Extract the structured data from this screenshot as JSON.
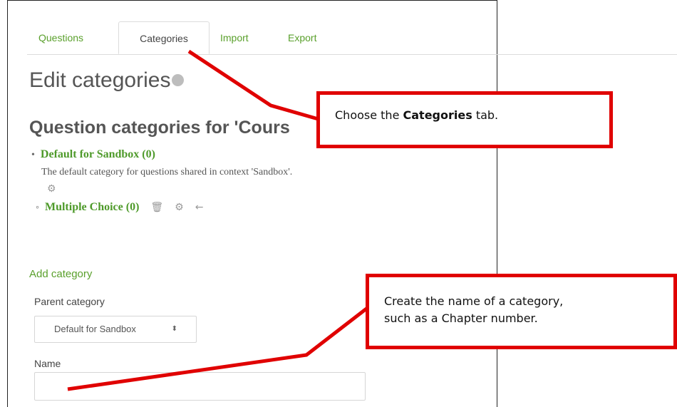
{
  "tabs": [
    {
      "label": "Questions"
    },
    {
      "label": "Categories"
    },
    {
      "label": "Import"
    },
    {
      "label": "Export"
    }
  ],
  "page_title": "Edit categories",
  "section_title": "Question categories for 'Cours",
  "categories": {
    "default": {
      "label": "Default for Sandbox (0)",
      "description": "The default category for questions shared in context 'Sandbox'."
    },
    "child": {
      "label": "Multiple Choice (0)"
    }
  },
  "icons": {
    "help": "help-icon",
    "gear": "gear-icon",
    "delete": "trash-icon",
    "move": "arrow-left-icon",
    "select_arrow": "updown-icon"
  },
  "add_category": {
    "heading": "Add category",
    "parent_label": "Parent category",
    "parent_value": "Default for Sandbox",
    "name_label": "Name",
    "name_value": ""
  },
  "callouts": {
    "tab_hint_prefix": "Choose the ",
    "tab_hint_bold": "Categories",
    "tab_hint_suffix": " tab.",
    "name_hint_line1": "Create the name of a category,",
    "name_hint_line2": "such as a Chapter number."
  },
  "colors": {
    "link_green": "#5aa02c",
    "annotation_red": "#e00000"
  }
}
